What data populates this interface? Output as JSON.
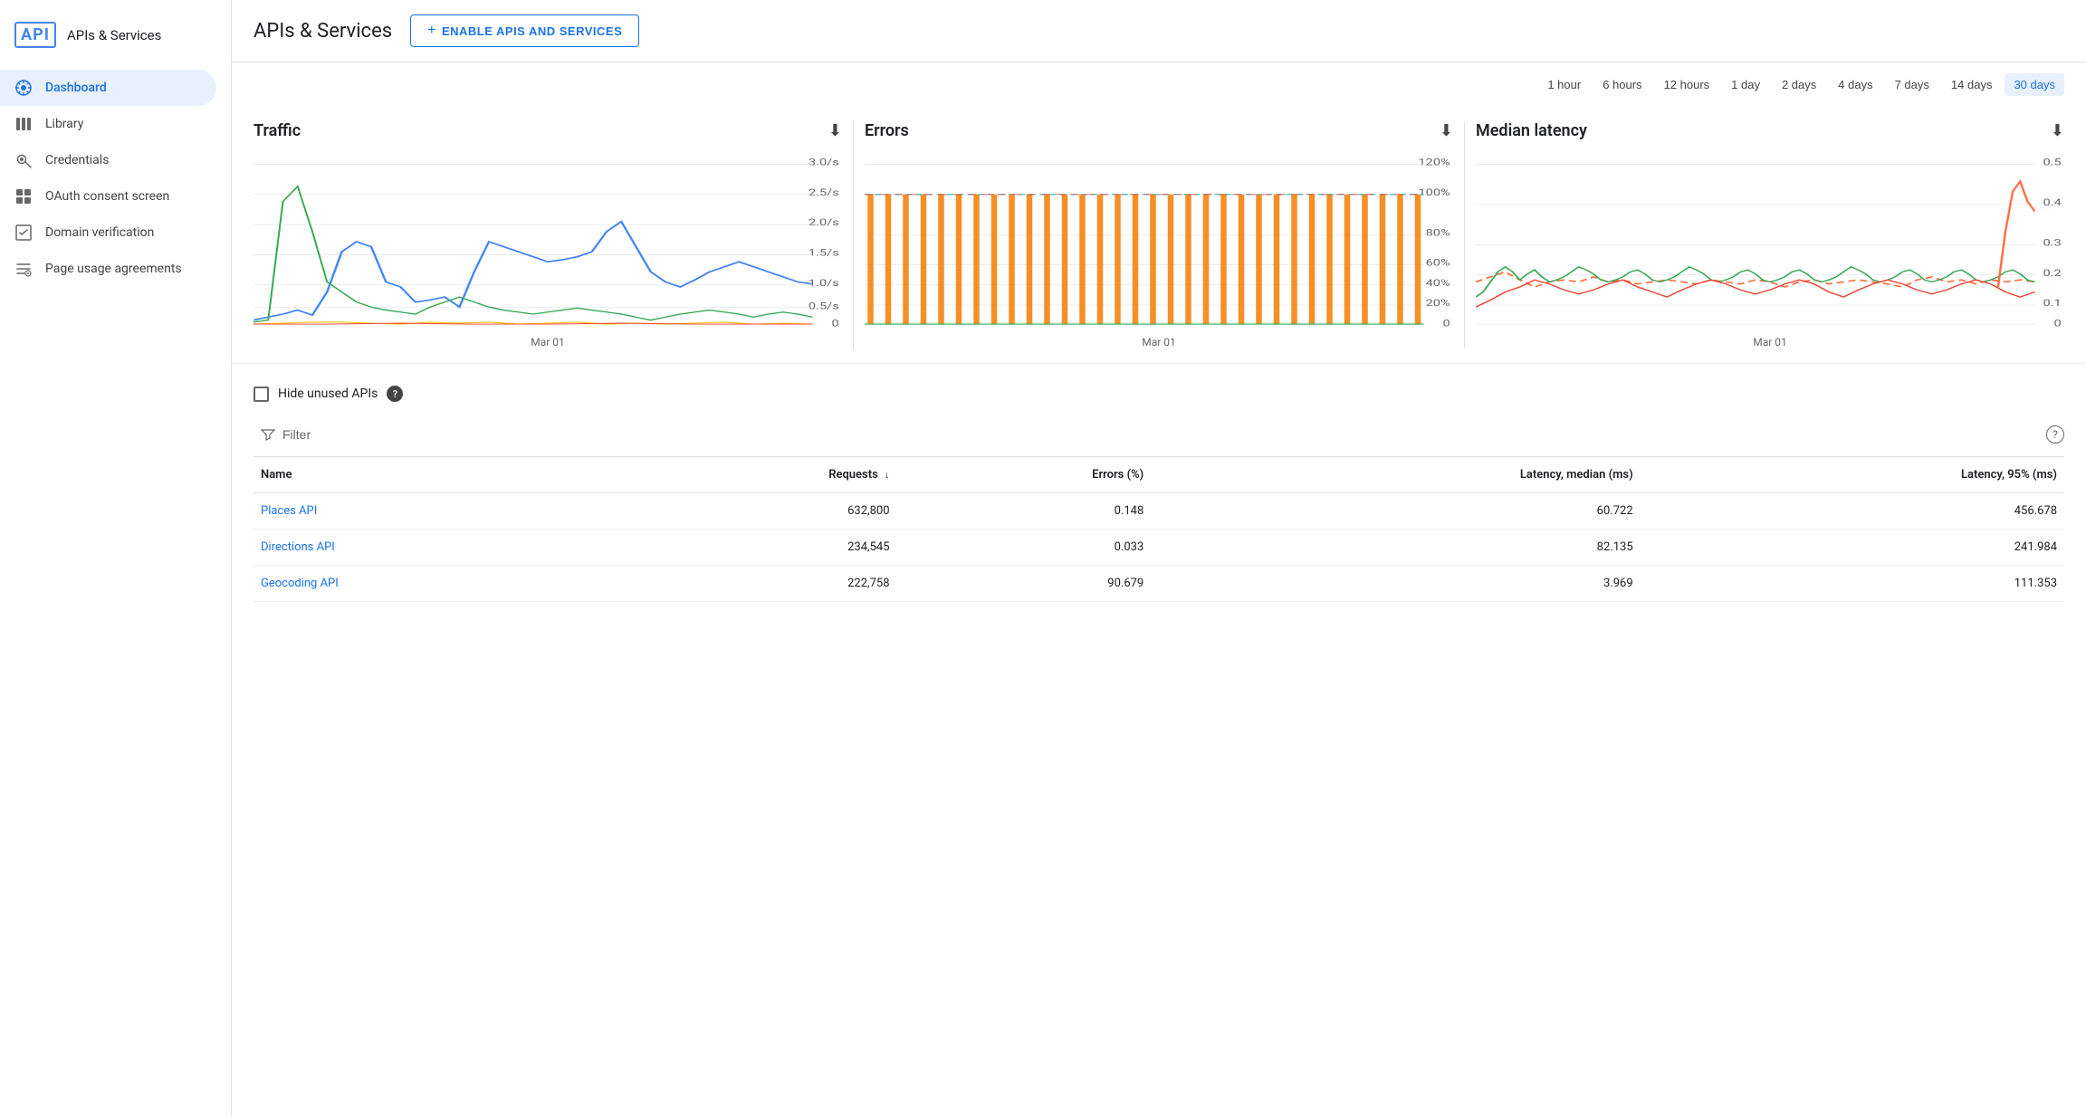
{
  "sidebar": {
    "logo": "API",
    "app_name": "APIs & Services",
    "nav_items": [
      {
        "id": "dashboard",
        "label": "Dashboard",
        "icon": "⬡",
        "active": true
      },
      {
        "id": "library",
        "label": "Library",
        "icon": "▦",
        "active": false
      },
      {
        "id": "credentials",
        "label": "Credentials",
        "icon": "⚿",
        "active": false
      },
      {
        "id": "oauth",
        "label": "OAuth consent screen",
        "icon": "⊞",
        "active": false
      },
      {
        "id": "domain",
        "label": "Domain verification",
        "icon": "☑",
        "active": false
      },
      {
        "id": "page-usage",
        "label": "Page usage agreements",
        "icon": "≡",
        "active": false
      }
    ]
  },
  "header": {
    "title": "APIs & Services",
    "enable_button": "ENABLE APIS AND SERVICES"
  },
  "time_range": {
    "options": [
      "1 hour",
      "6 hours",
      "12 hours",
      "1 day",
      "2 days",
      "4 days",
      "7 days",
      "14 days",
      "30 days"
    ],
    "active": "30 days"
  },
  "charts": [
    {
      "id": "traffic",
      "title": "Traffic",
      "x_label": "Mar 01"
    },
    {
      "id": "errors",
      "title": "Errors",
      "x_label": "Mar 01"
    },
    {
      "id": "median_latency",
      "title": "Median latency",
      "x_label": "Mar 01"
    }
  ],
  "controls": {
    "hide_unused_label": "Hide unused APIs"
  },
  "table": {
    "filter_placeholder": "Filter",
    "columns": [
      "Name",
      "Requests",
      "Errors (%)",
      "Latency, median (ms)",
      "Latency, 95% (ms)"
    ],
    "rows": [
      {
        "name": "Places API",
        "requests": "632,800",
        "errors": "0.148",
        "latency_median": "60.722",
        "latency_95": "456.678"
      },
      {
        "name": "Directions API",
        "requests": "234,545",
        "errors": "0.033",
        "latency_median": "82.135",
        "latency_95": "241.984"
      },
      {
        "name": "Geocoding API",
        "requests": "222,758",
        "errors": "90.679",
        "latency_median": "3.969",
        "latency_95": "111.353"
      }
    ]
  },
  "colors": {
    "accent": "#1a73e8",
    "brand": "#4285f4",
    "active_nav_bg": "#e8f0fe",
    "active_btn_bg": "#e8f0fe"
  }
}
